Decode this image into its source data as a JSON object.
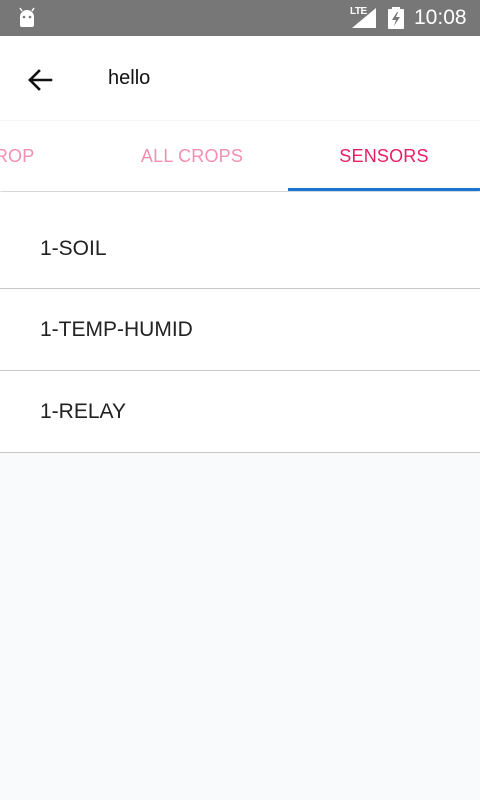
{
  "status_bar": {
    "network_label": "LTE",
    "time": "10:08",
    "icons": [
      "android-icon",
      "signal-icon",
      "battery-charging-icon"
    ]
  },
  "app_bar": {
    "title": "hello",
    "back_icon": "arrow-back-icon"
  },
  "tabs": [
    {
      "label": "CURRENT CROP",
      "visible_label": "T CROP",
      "active": false
    },
    {
      "label": "ALL CROPS",
      "active": false
    },
    {
      "label": "SENSORS",
      "active": true
    }
  ],
  "sensors": [
    {
      "name": "1-SOIL"
    },
    {
      "name": "1-TEMP-HUMID"
    },
    {
      "name": "1-RELAY"
    }
  ],
  "colors": {
    "status_bar": "#777777",
    "tab_active": "#e91e63",
    "tab_inactive": "#f48fb1",
    "tab_indicator": "#1976d2",
    "background": "#f9fafc"
  }
}
